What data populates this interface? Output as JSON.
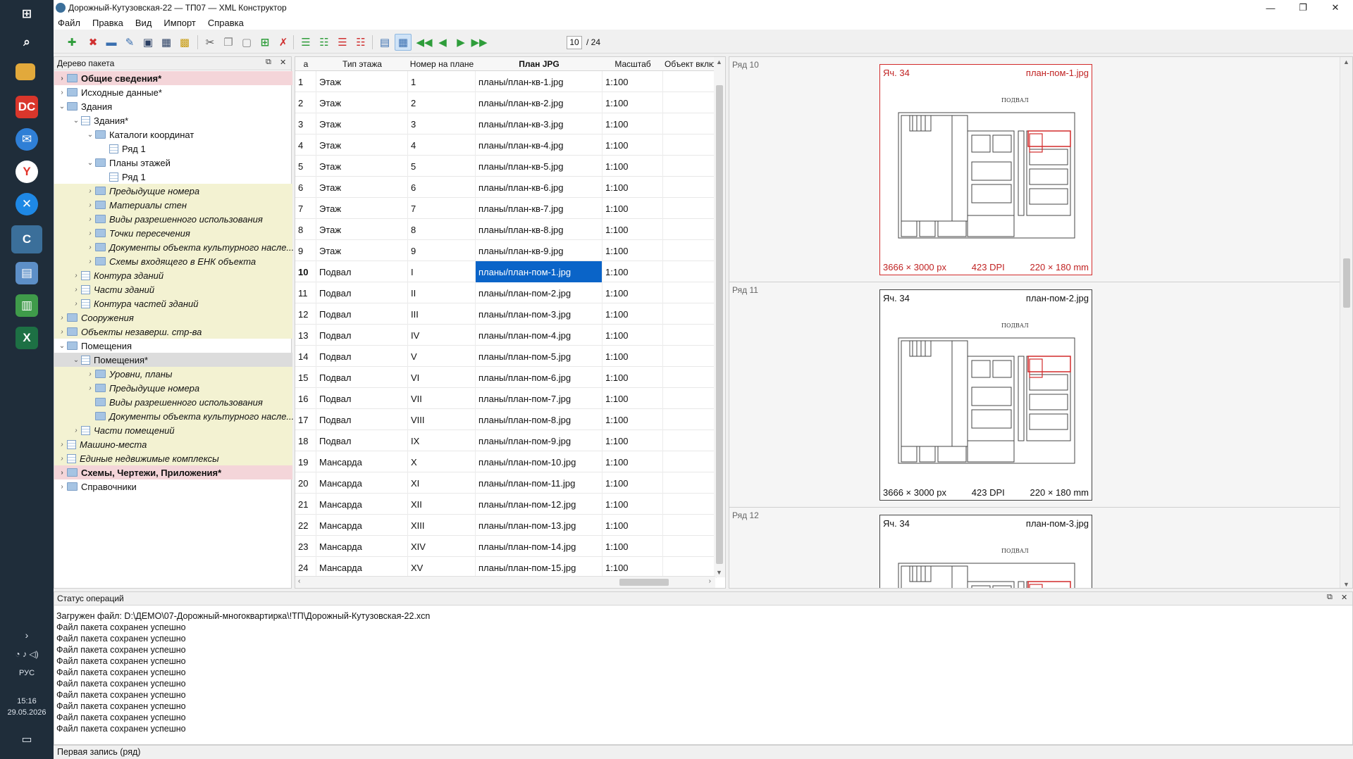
{
  "taskbar": {
    "lang": "РУС",
    "time": "15:16",
    "date": "29.05.2026",
    "icons": [
      "windows-icon",
      "search-icon",
      "file-explorer-icon",
      "dc-app-icon",
      "thunderbird-icon",
      "yandex-browser-icon",
      "x-app-icon",
      "xml-constructor-icon",
      "clipboard-app-icon",
      "chart-app-icon",
      "excel-icon"
    ]
  },
  "window": {
    "title": "Дорожный-Кутузовская-22 — ТП07 — XML Конструктор",
    "minimize": "—",
    "maximize": "❐",
    "close": "✕"
  },
  "menu": [
    "Файл",
    "Правка",
    "Вид",
    "Импорт",
    "Справка"
  ],
  "toolbar": {
    "page_current": "10",
    "page_total": "/ 24"
  },
  "tree": {
    "header": "Дерево пакета",
    "float_icon": "⧉",
    "close_icon": "✕",
    "items": [
      {
        "label": "Общие сведения*",
        "level": 0,
        "chev": "›",
        "icon": "folder",
        "style": "pink bold"
      },
      {
        "label": "Исходные данные*",
        "level": 0,
        "chev": "›",
        "icon": "folder",
        "style": ""
      },
      {
        "label": "Здания",
        "level": 0,
        "chev": "⌄",
        "icon": "folder",
        "style": ""
      },
      {
        "label": "Здания*",
        "level": 1,
        "chev": "⌄",
        "icon": "list",
        "style": ""
      },
      {
        "label": "Каталоги координат",
        "level": 2,
        "chev": "⌄",
        "icon": "folder",
        "style": ""
      },
      {
        "label": "Ряд 1",
        "level": 3,
        "chev": "",
        "icon": "list",
        "style": ""
      },
      {
        "label": "Планы этажей",
        "level": 2,
        "chev": "⌄",
        "icon": "folder",
        "style": ""
      },
      {
        "label": "Ряд 1",
        "level": 3,
        "chev": "",
        "icon": "list",
        "style": ""
      },
      {
        "label": "Предыдущие номера",
        "level": 2,
        "chev": "›",
        "icon": "folder",
        "style": "yellow italic"
      },
      {
        "label": "Материалы стен",
        "level": 2,
        "chev": "›",
        "icon": "folder",
        "style": "yellow italic"
      },
      {
        "label": "Виды разрешенного использования",
        "level": 2,
        "chev": "›",
        "icon": "folder",
        "style": "yellow italic"
      },
      {
        "label": "Точки пересечения",
        "level": 2,
        "chev": "›",
        "icon": "folder",
        "style": "yellow italic"
      },
      {
        "label": "Документы объекта культурного насле...",
        "level": 2,
        "chev": "›",
        "icon": "folder",
        "style": "yellow italic"
      },
      {
        "label": "Схемы входящего в ЕНК объекта",
        "level": 2,
        "chev": "›",
        "icon": "folder",
        "style": "yellow italic"
      },
      {
        "label": "Контура зданий",
        "level": 1,
        "chev": "›",
        "icon": "list",
        "style": "yellow italic"
      },
      {
        "label": "Части зданий",
        "level": 1,
        "chev": "›",
        "icon": "list",
        "style": "yellow italic"
      },
      {
        "label": "Контура частей зданий",
        "level": 1,
        "chev": "›",
        "icon": "list",
        "style": "yellow italic"
      },
      {
        "label": "Сооружения",
        "level": 0,
        "chev": "›",
        "icon": "folder",
        "style": "yellow italic"
      },
      {
        "label": "Объекты незаверш. стр-ва",
        "level": 0,
        "chev": "›",
        "icon": "folder",
        "style": "yellow italic"
      },
      {
        "label": "Помещения",
        "level": 0,
        "chev": "⌄",
        "icon": "folder",
        "style": ""
      },
      {
        "label": "Помещения*",
        "level": 1,
        "chev": "⌄",
        "icon": "list",
        "style": "selected"
      },
      {
        "label": "Уровни, планы",
        "level": 2,
        "chev": "›",
        "icon": "folder",
        "style": "yellow italic"
      },
      {
        "label": "Предыдущие номера",
        "level": 2,
        "chev": "›",
        "icon": "folder",
        "style": "yellow italic"
      },
      {
        "label": "Виды разрешенного использования",
        "level": 2,
        "chev": "",
        "icon": "folder",
        "style": "yellow italic"
      },
      {
        "label": "Документы объекта культурного насле...",
        "level": 2,
        "chev": "",
        "icon": "folder",
        "style": "yellow italic"
      },
      {
        "label": "Части помещений",
        "level": 1,
        "chev": "›",
        "icon": "list",
        "style": "yellow italic"
      },
      {
        "label": "Машино-места",
        "level": 0,
        "chev": "›",
        "icon": "list",
        "style": "yellow italic"
      },
      {
        "label": "Единые недвижимые комплексы",
        "level": 0,
        "chev": "›",
        "icon": "list",
        "style": "yellow italic"
      },
      {
        "label": "Схемы, Чертежи, Приложения*",
        "level": 0,
        "chev": "›",
        "icon": "folder",
        "style": "pink bold"
      },
      {
        "label": "Справочники",
        "level": 0,
        "chev": "›",
        "icon": "folder",
        "style": ""
      }
    ]
  },
  "grid": {
    "columns": [
      "а",
      "Тип этажа",
      "Номер на плане",
      "План JPG",
      "Масштаб",
      "Объект вклю"
    ],
    "selected_row": 10,
    "rows": [
      {
        "n": "1",
        "type": "Этаж",
        "num": "1",
        "jpg": "планы/план-кв-1.jpg",
        "scale": "1:100"
      },
      {
        "n": "2",
        "type": "Этаж",
        "num": "2",
        "jpg": "планы/план-кв-2.jpg",
        "scale": "1:100"
      },
      {
        "n": "3",
        "type": "Этаж",
        "num": "3",
        "jpg": "планы/план-кв-3.jpg",
        "scale": "1:100"
      },
      {
        "n": "4",
        "type": "Этаж",
        "num": "4",
        "jpg": "планы/план-кв-4.jpg",
        "scale": "1:100"
      },
      {
        "n": "5",
        "type": "Этаж",
        "num": "5",
        "jpg": "планы/план-кв-5.jpg",
        "scale": "1:100"
      },
      {
        "n": "6",
        "type": "Этаж",
        "num": "6",
        "jpg": "планы/план-кв-6.jpg",
        "scale": "1:100"
      },
      {
        "n": "7",
        "type": "Этаж",
        "num": "7",
        "jpg": "планы/план-кв-7.jpg",
        "scale": "1:100"
      },
      {
        "n": "8",
        "type": "Этаж",
        "num": "8",
        "jpg": "планы/план-кв-8.jpg",
        "scale": "1:100"
      },
      {
        "n": "9",
        "type": "Этаж",
        "num": "9",
        "jpg": "планы/план-кв-9.jpg",
        "scale": "1:100"
      },
      {
        "n": "10",
        "type": "Подвал",
        "num": "I",
        "jpg": "планы/план-пом-1.jpg",
        "scale": "1:100"
      },
      {
        "n": "11",
        "type": "Подвал",
        "num": "II",
        "jpg": "планы/план-пом-2.jpg",
        "scale": "1:100"
      },
      {
        "n": "12",
        "type": "Подвал",
        "num": "III",
        "jpg": "планы/план-пом-3.jpg",
        "scale": "1:100"
      },
      {
        "n": "13",
        "type": "Подвал",
        "num": "IV",
        "jpg": "планы/план-пом-4.jpg",
        "scale": "1:100"
      },
      {
        "n": "14",
        "type": "Подвал",
        "num": "V",
        "jpg": "планы/план-пом-5.jpg",
        "scale": "1:100"
      },
      {
        "n": "15",
        "type": "Подвал",
        "num": "VI",
        "jpg": "планы/план-пом-6.jpg",
        "scale": "1:100"
      },
      {
        "n": "16",
        "type": "Подвал",
        "num": "VII",
        "jpg": "планы/план-пом-7.jpg",
        "scale": "1:100"
      },
      {
        "n": "17",
        "type": "Подвал",
        "num": "VIII",
        "jpg": "планы/план-пом-8.jpg",
        "scale": "1:100"
      },
      {
        "n": "18",
        "type": "Подвал",
        "num": "IX",
        "jpg": "планы/план-пом-9.jpg",
        "scale": "1:100"
      },
      {
        "n": "19",
        "type": "Мансарда",
        "num": "X",
        "jpg": "планы/план-пом-10.jpg",
        "scale": "1:100"
      },
      {
        "n": "20",
        "type": "Мансарда",
        "num": "XI",
        "jpg": "планы/план-пом-11.jpg",
        "scale": "1:100"
      },
      {
        "n": "21",
        "type": "Мансарда",
        "num": "XII",
        "jpg": "планы/план-пом-12.jpg",
        "scale": "1:100"
      },
      {
        "n": "22",
        "type": "Мансарда",
        "num": "XIII",
        "jpg": "планы/план-пом-13.jpg",
        "scale": "1:100"
      },
      {
        "n": "23",
        "type": "Мансарда",
        "num": "XIV",
        "jpg": "планы/план-пом-14.jpg",
        "scale": "1:100"
      },
      {
        "n": "24",
        "type": "Мансарда",
        "num": "XV",
        "jpg": "планы/план-пом-15.jpg",
        "scale": "1:100"
      }
    ]
  },
  "preview": {
    "plan_title": "ПОДВАЛ",
    "cells": [
      {
        "row_label": "Ряд 10",
        "cell": "Яч. 34",
        "file": "план-пом-1.jpg",
        "px": "3666 × 3000 px",
        "dpi": "423 DPI",
        "mm": "220 × 180 mm",
        "selected": true
      },
      {
        "row_label": "Ряд 11",
        "cell": "Яч. 34",
        "file": "план-пом-2.jpg",
        "px": "3666 × 3000 px",
        "dpi": "423 DPI",
        "mm": "220 × 180 mm",
        "selected": false
      },
      {
        "row_label": "Ряд 12",
        "cell": "Яч. 34",
        "file": "план-пом-3.jpg",
        "px": "",
        "dpi": "",
        "mm": "",
        "selected": false
      }
    ]
  },
  "status": {
    "header": "Статус операций",
    "lines": [
      "Загружен файл: D:\\ДЕМО\\07-Дорожный-многоквартирка\\!ТП\\Дорожный-Кутузовская-22.xcn",
      "Файл пакета сохранен успешно",
      "Файл пакета сохранен успешно",
      "Файл пакета сохранен успешно",
      "Файл пакета сохранен успешно",
      "Файл пакета сохранен успешно",
      "Файл пакета сохранен успешно",
      "Файл пакета сохранен успешно",
      "Файл пакета сохранен успешно",
      "Файл пакета сохранен успешно",
      "Файл пакета сохранен успешно"
    ]
  },
  "statusbar": "Первая запись (ряд)",
  "colors": {
    "selection": "#0a64c8",
    "pink": "#f4d5d9",
    "yellow": "#f3f2d2",
    "preview_selected": "#d22b2b"
  }
}
